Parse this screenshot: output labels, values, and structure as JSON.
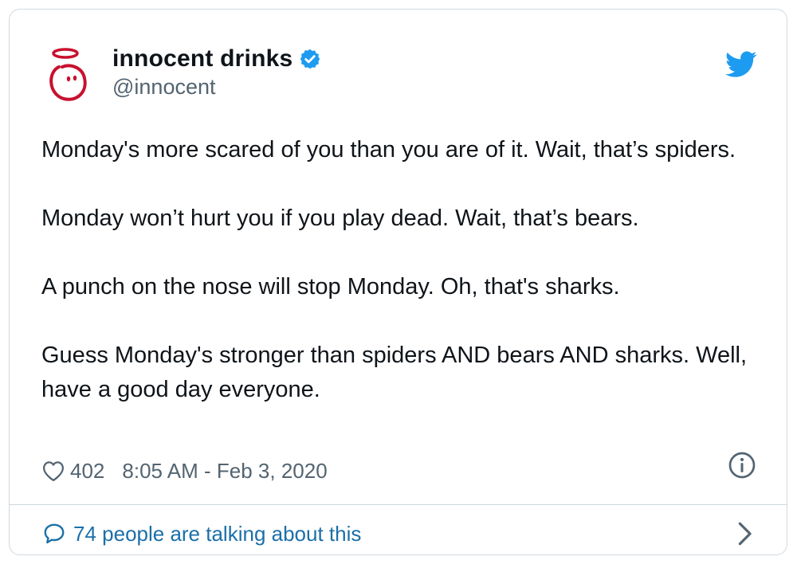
{
  "author": {
    "name": "innocent drinks",
    "handle": "@innocent",
    "verified_icon": "verified-badge-icon",
    "avatar_icon": "innocent-logo-icon"
  },
  "platform_icon": "twitter-bird-icon",
  "tweet": {
    "paragraphs": [
      "Monday's more scared of you than you are of it. Wait, that’s spiders.",
      "Monday won’t hurt you if you play dead. Wait, that’s bears.",
      "A punch on the nose will stop Monday. Oh, that's sharks.",
      "Guess Monday's stronger than spiders AND bears AND sharks. Well, have a good day everyone."
    ]
  },
  "meta": {
    "like_icon": "heart-icon",
    "likes": "402",
    "timestamp": "8:05 AM - Feb 3, 2020",
    "info_icon": "info-icon"
  },
  "footer": {
    "bubble_icon": "speech-bubble-icon",
    "talking_label": "74 people are talking about this",
    "chevron_icon": "chevron-right-icon"
  },
  "colors": {
    "twitter_blue": "#1d9bf0",
    "link_blue": "#1b6fa8",
    "secondary_text": "#536471",
    "logo_red": "#c8102e"
  }
}
